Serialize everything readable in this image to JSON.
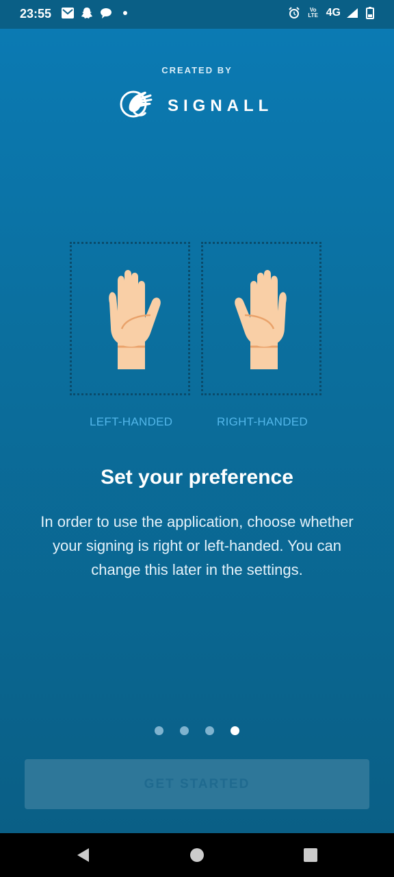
{
  "status_bar": {
    "time": "23:55",
    "network": "4G",
    "lte": "Vo LTE",
    "left_icons": [
      "gmail-icon",
      "snapchat-icon",
      "chat-icon",
      "dot-icon"
    ],
    "right_icons": [
      "alarm-icon",
      "volte-icon",
      "signal-icon",
      "battery-icon"
    ]
  },
  "header": {
    "created_by": "CREATED BY",
    "brand": "SIGNALL"
  },
  "options": {
    "left_label": "LEFT-HANDED",
    "right_label": "RIGHT-HANDED"
  },
  "content": {
    "title": "Set your preference",
    "description": "In order to use the application, choose whether your signing is right or left-handed. You can change this later in the settings."
  },
  "pager": {
    "total": 4,
    "active_index": 3
  },
  "actions": {
    "get_started": "GET STARTED"
  },
  "colors": {
    "background_top": "#0b7bb5",
    "background_bottom": "#0a5f86",
    "label": "#53b7ea",
    "skin": "#f9cfa6",
    "skin_shadow": "#e9a26a"
  }
}
